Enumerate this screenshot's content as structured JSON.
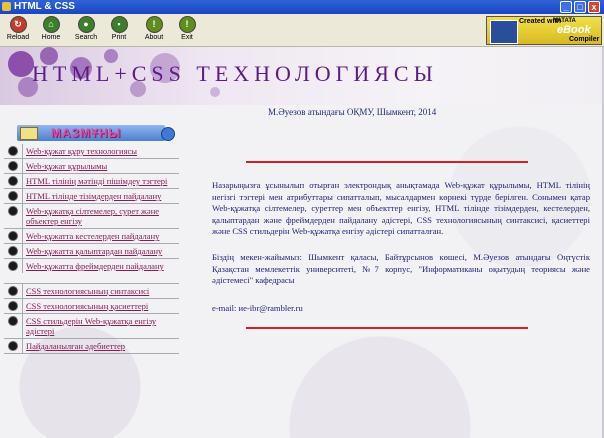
{
  "window": {
    "title": "HTML & CSS",
    "min": "_",
    "max": "□",
    "close": "x"
  },
  "toolbar": {
    "buttons": [
      {
        "label": "Reload",
        "icon": "reload-icon",
        "glyph": "↻",
        "color": "#c43c2a"
      },
      {
        "label": "Home",
        "icon": "home-icon",
        "glyph": "⌂",
        "color": "#3b7f2a"
      },
      {
        "label": "Search",
        "icon": "search-icon",
        "glyph": "●",
        "color": "#3d7f2a"
      },
      {
        "label": "Print",
        "icon": "print-icon",
        "glyph": "▪",
        "color": "#3b7f2a"
      },
      {
        "label": "About",
        "icon": "info-icon",
        "glyph": "!",
        "color": "#5e8f1e"
      },
      {
        "label": "Exit",
        "icon": "exit-icon",
        "glyph": "!",
        "color": "#5e8f1e"
      }
    ]
  },
  "badge": {
    "line1": "Created with",
    "line2": "NATATA",
    "line3": "eBook",
    "line4": "Compiler"
  },
  "header": {
    "title": "HTML+CSS ТЕХНОЛОГИЯСЫ",
    "subtitle": "М.Әуезов атындағы ОҚМУ, Шымкент, 2014"
  },
  "sidebar": {
    "title": "МАЗМҰНЫ",
    "items": [
      "Web-құжат құру технологиясы",
      "Web-құжат құрылымы",
      "HTML тілінің мәтінді пішімдеу тэгтері",
      "HTML тілінде тізімдерден пайдалану",
      "Web-құжатқа сілтемелер, сурет және объектер енгізу",
      "Web-құжатта кестелерден пайдалану",
      "Web-құжатта қалыптардан пайдалану",
      "Web-құжатта фреймдерден пайдалану",
      "CSS технологиясының синтаксисі",
      "CSS технологиясының қасиеттері",
      "CSS стильдерін Web-құжатқа енгізу әдістері",
      "Пайдаланылған әдебиеттер"
    ]
  },
  "main": {
    "paragraph1": "Назарыңызға ұсынылып отырған электрондық анықтамада Web-құжат құрылымы, HTML тілінің негізгі тэгтері мен атрибуттары сипатталып, мысалдармен көрнекі түрде берілген. Сонымен қатар Web-құжатқа сілтемелер, суреттер мен объекттер енгізу, HTML тілінде тізімдерден, кестелерден, қалыптардан және фреймдерден пайдалану әдістері, CSS технологиясының синтаксисі, қасиеттері және CSS стильдерін Web-құжатқа енгізу әдістері сипатталған.",
    "paragraph2": "Біздің мекен-жайымыз: Шымкент қаласы, Байтұрсынов көшесі, М.Әуезов атындағы Оңтүстік Қазақстан мемлекеттік университеті, №7 корпус, \"Информатиканы оқытудың теориясы және әдістемесі\" кафедрасы",
    "email": "e-mail: ие-ibr@rambler.ru"
  },
  "colors": {
    "accent_red": "#d32020",
    "title_purple": "#5e1a8a",
    "link": "#8a1c55",
    "text": "#20237a"
  }
}
